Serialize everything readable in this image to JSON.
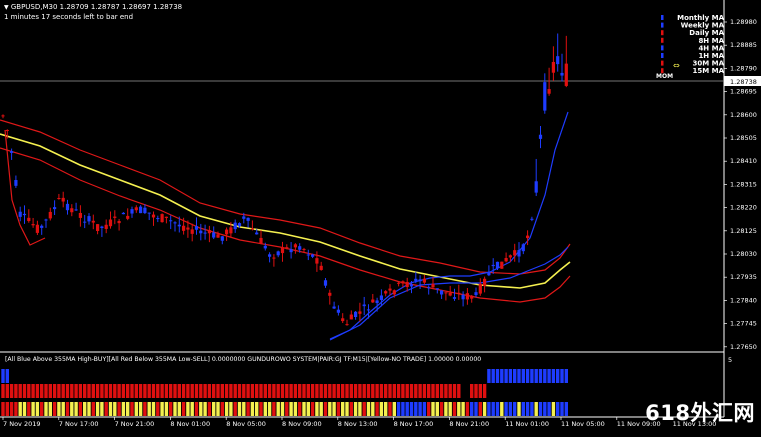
{
  "header": {
    "symbol_ohlc": "GBPUSD,M30  1.28709 1.28787 1.28697 1.28738",
    "countdown": "1 minutes 17 seconds left to bar end"
  },
  "price_axis": {
    "labels": [
      "1.28980",
      "1.28885",
      "1.28790",
      "1.28695",
      "1.28600",
      "1.28505",
      "1.28410",
      "1.28315",
      "1.28220",
      "1.28125",
      "1.28030",
      "1.27935",
      "1.27840",
      "1.27745",
      "1.27650"
    ],
    "current_price": "1.28738",
    "subwindow_scale": "5"
  },
  "time_axis": {
    "labels": [
      "7 Nov 2019",
      "7 Nov 17:00",
      "7 Nov 21:00",
      "8 Nov 01:00",
      "8 Nov 05:00",
      "8 Nov 09:00",
      "8 Nov 13:00",
      "8 Nov 17:00",
      "8 Nov 21:00",
      "11 Nov 01:00",
      "11 Nov 05:00",
      "11 Nov 09:00",
      "11 Nov 13:00"
    ]
  },
  "ma_legend": {
    "items": [
      "Monthly MA",
      "Weekly MA",
      "Daily MA",
      "8H MA",
      "4H MA",
      "1H MA",
      "30M MA",
      "15M MA"
    ],
    "mom_label": "MOM"
  },
  "indicator": {
    "text": "[All Blue Above 355MA High-BUY][All Red Below 355MA Low-SELL] 0.0000000  GUNDUROWO SYSTEM|PAIR:GJ TF:M15|[Yellow-NO TRADE] 1.00000 0.00000"
  },
  "watermark": "618外汇网",
  "colors": {
    "background": "#000000",
    "bull_candle": "#1e3cff",
    "bear_candle": "#e01010",
    "red_envelope": "#e01818",
    "yellow_ma": "#f5f050",
    "blue_ma": "#1e3cff",
    "histogram_blue": "#1e3cff",
    "histogram_red": "#e01010",
    "histogram_yellow": "#f5f050"
  }
}
